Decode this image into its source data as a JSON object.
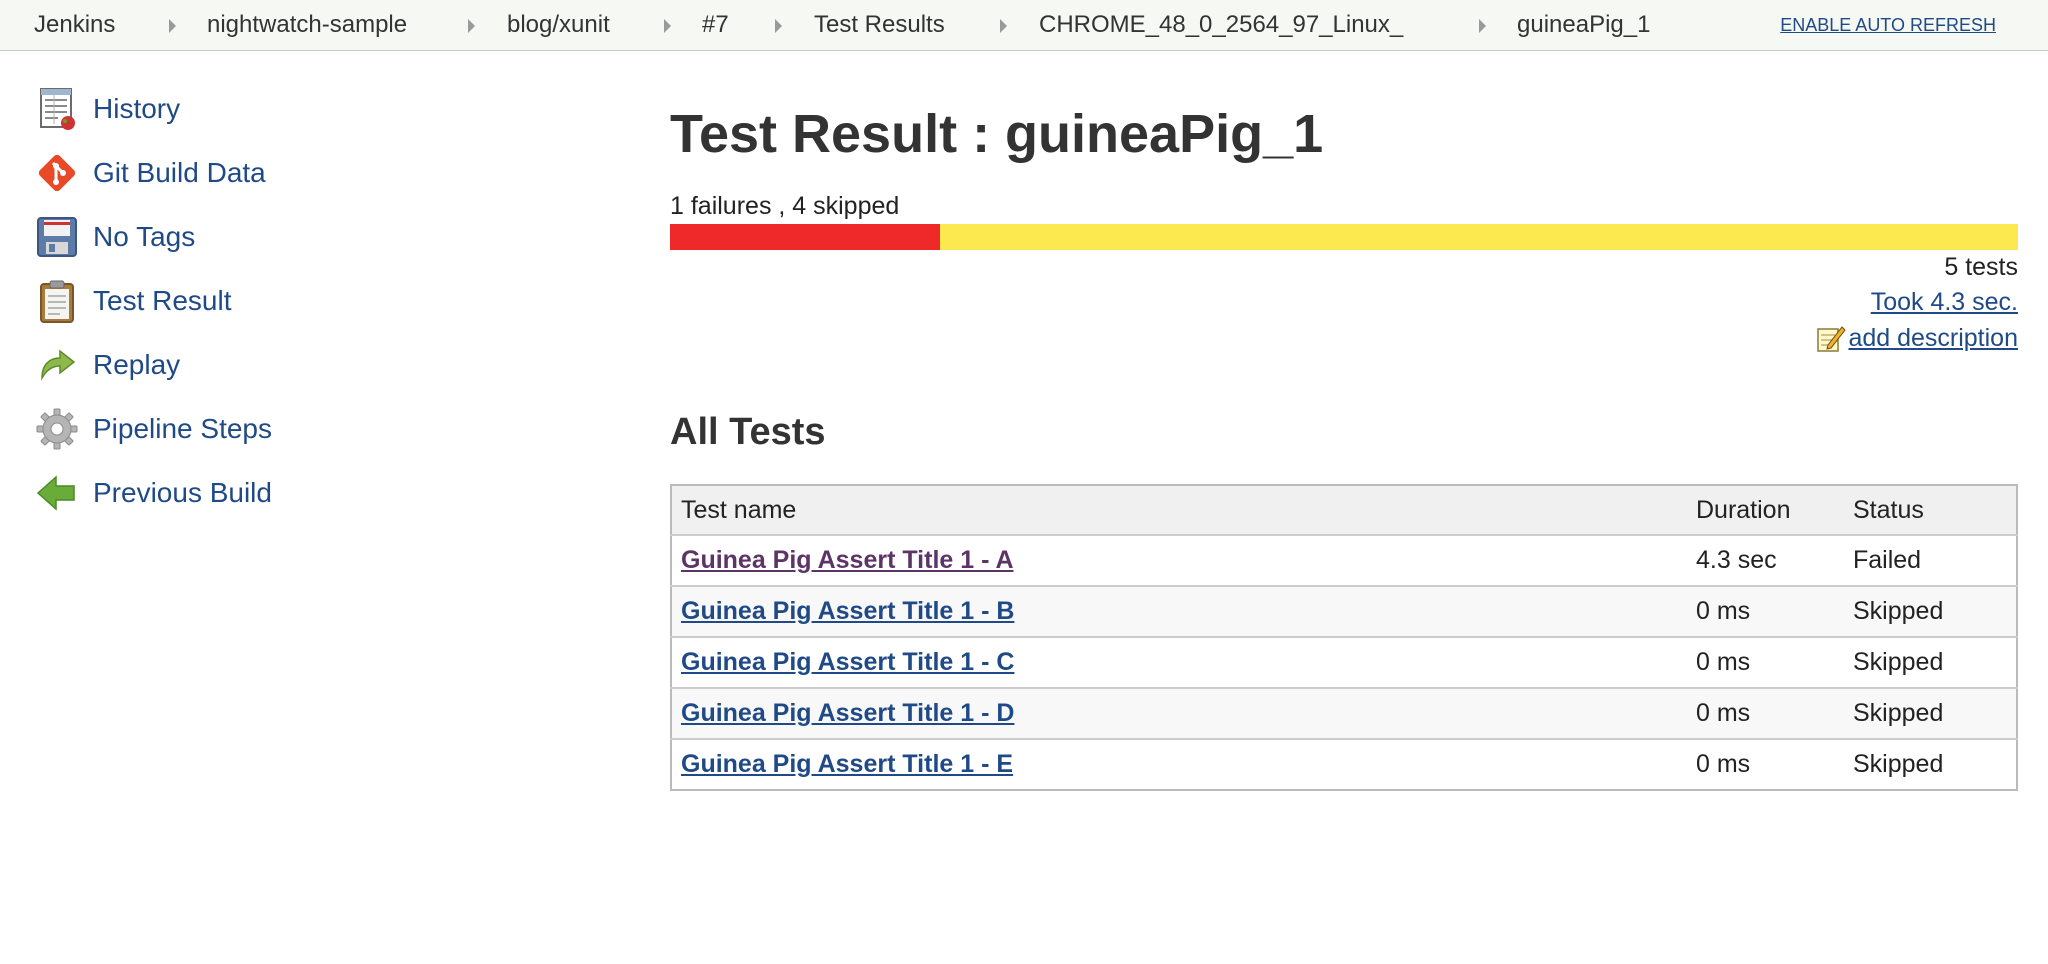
{
  "breadcrumb": {
    "items": [
      "Jenkins",
      "nightwatch-sample",
      "blog/xunit",
      "#7",
      "Test Results",
      "CHROME_48_0_2564_97_Linux_",
      "guineaPig_1"
    ],
    "auto_refresh": "ENABLE AUTO REFRESH"
  },
  "sidebar": {
    "items": [
      {
        "label": "History",
        "icon": "history-icon"
      },
      {
        "label": "Git Build Data",
        "icon": "git-icon"
      },
      {
        "label": "No Tags",
        "icon": "floppy-disk-icon"
      },
      {
        "label": "Test Result",
        "icon": "clipboard-icon"
      },
      {
        "label": "Replay",
        "icon": "replay-arrow-icon"
      },
      {
        "label": "Pipeline Steps",
        "icon": "gear-icon"
      },
      {
        "label": "Previous Build",
        "icon": "left-arrow-icon"
      }
    ]
  },
  "main": {
    "title": "Test Result : guineaPig_1",
    "summary": "1 failures , 4 skipped",
    "progress": {
      "failed": 1,
      "skipped": 4,
      "total": 5
    },
    "test_count": "5 tests",
    "took": "Took 4.3 sec.",
    "add_description": "add description",
    "section_title": "All Tests"
  },
  "table": {
    "headers": [
      "Test name",
      "Duration",
      "Status"
    ],
    "rows": [
      {
        "name": "Guinea Pig Assert Title 1 - A",
        "duration": "4.3 sec",
        "status": "Failed"
      },
      {
        "name": "Guinea Pig Assert Title 1 - B",
        "duration": "0 ms",
        "status": "Skipped"
      },
      {
        "name": "Guinea Pig Assert Title 1 - C",
        "duration": "0 ms",
        "status": "Skipped"
      },
      {
        "name": "Guinea Pig Assert Title 1 - D",
        "duration": "0 ms",
        "status": "Skipped"
      },
      {
        "name": "Guinea Pig Assert Title 1 - E",
        "duration": "0 ms",
        "status": "Skipped"
      }
    ]
  },
  "colors": {
    "failed": "#ef2929",
    "skipped_bar": "#fce94f",
    "skipped_text": "#d4a800",
    "link": "#204a87"
  }
}
